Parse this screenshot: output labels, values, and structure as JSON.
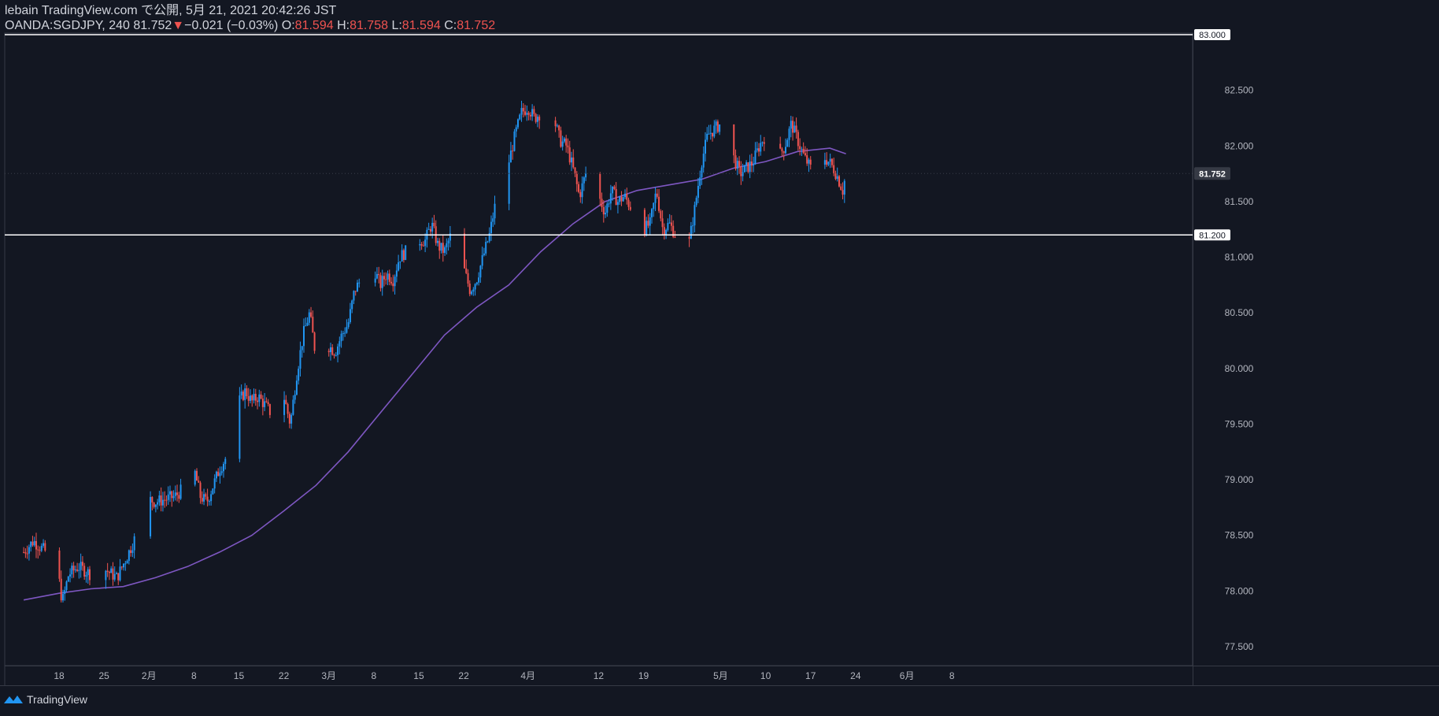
{
  "header": {
    "publish_line": "lebain TradingView.com で公開, 5月 21, 2021 20:42:26 JST",
    "symbol": "OANDA:SGDJPY, 240",
    "last": "81.752",
    "change_arrow": "▼",
    "change": "−0.021 (−0.03%)",
    "o_label": "O:",
    "o_value": "81.594",
    "h_label": "H:",
    "h_value": "81.758",
    "l_label": "L:",
    "l_value": "81.594",
    "c_label": "C:",
    "c_value": "81.752"
  },
  "footer": {
    "brand": "TradingView",
    "logo_icon": "tradingview-logo-icon"
  },
  "colors": {
    "background": "#131722",
    "up": "#2196f3",
    "down": "#ef5350",
    "ma": "#7e57c2",
    "hline": "#ffffff",
    "axis_text": "#b2b5be"
  },
  "chart_data": {
    "type": "candlestick",
    "symbol": "OANDA:SGDJPY",
    "interval": "240",
    "ylim": [
      77.3,
      83.0
    ],
    "y_ticks": [
      "83.000",
      "82.500",
      "82.000",
      "81.500",
      "81.000",
      "80.500",
      "80.000",
      "79.500",
      "79.000",
      "78.500",
      "78.000",
      "77.500"
    ],
    "y_tick_values": [
      83.0,
      82.5,
      82.0,
      81.5,
      81.0,
      80.5,
      80.0,
      79.5,
      79.0,
      78.5,
      78.0,
      77.5
    ],
    "x_ticks": [
      {
        "label": "18",
        "day": 0
      },
      {
        "label": "25",
        "day": 7
      },
      {
        "label": "2月",
        "day": 14
      },
      {
        "label": "8",
        "day": 21
      },
      {
        "label": "15",
        "day": 28
      },
      {
        "label": "22",
        "day": 35
      },
      {
        "label": "3月",
        "day": 42
      },
      {
        "label": "8",
        "day": 49
      },
      {
        "label": "15",
        "day": 56
      },
      {
        "label": "22",
        "day": 63
      },
      {
        "label": "4月",
        "day": 73
      },
      {
        "label": "12",
        "day": 84
      },
      {
        "label": "19",
        "day": 91
      },
      {
        "label": "5月",
        "day": 103
      },
      {
        "label": "10",
        "day": 110
      },
      {
        "label": "17",
        "day": 117
      },
      {
        "label": "24",
        "day": 124
      },
      {
        "label": "6月",
        "day": 132
      },
      {
        "label": "8",
        "day": 139
      }
    ],
    "price_path": [
      [
        -5.5,
        78.35
      ],
      [
        -4,
        78.45
      ],
      [
        -2,
        78.35
      ],
      [
        -1,
        78.4
      ],
      [
        0,
        78.1
      ],
      [
        0.5,
        77.9
      ],
      [
        1.5,
        78.15
      ],
      [
        3,
        78.22
      ],
      [
        5,
        78.15
      ],
      [
        7,
        78.2
      ],
      [
        9,
        78.12
      ],
      [
        10.5,
        78.3
      ],
      [
        12,
        78.5
      ],
      [
        13,
        78.85
      ],
      [
        15,
        78.8
      ],
      [
        18,
        78.85
      ],
      [
        20,
        78.95
      ],
      [
        21,
        79.1
      ],
      [
        22,
        78.85
      ],
      [
        23,
        78.8
      ],
      [
        24,
        78.95
      ],
      [
        25,
        79.1
      ],
      [
        27,
        79.3
      ],
      [
        28,
        79.7
      ],
      [
        29,
        79.8
      ],
      [
        30,
        79.7
      ],
      [
        31,
        79.75
      ],
      [
        33,
        79.6
      ],
      [
        34,
        79.65
      ],
      [
        35,
        79.75
      ],
      [
        36,
        79.5
      ],
      [
        37,
        79.95
      ],
      [
        38,
        80.3
      ],
      [
        39,
        80.5
      ],
      [
        40,
        80.1
      ],
      [
        41,
        80.0
      ],
      [
        42,
        80.2
      ],
      [
        43,
        80.15
      ],
      [
        44,
        80.3
      ],
      [
        45,
        80.4
      ],
      [
        46,
        80.7
      ],
      [
        47,
        80.8
      ],
      [
        48,
        80.7
      ],
      [
        49,
        80.9
      ],
      [
        50,
        80.75
      ],
      [
        51,
        80.85
      ],
      [
        52,
        80.8
      ],
      [
        53,
        81.0
      ],
      [
        55,
        81.1
      ],
      [
        56,
        81.15
      ],
      [
        57,
        81.15
      ],
      [
        58,
        81.3
      ],
      [
        59,
        81.1
      ],
      [
        60,
        81.05
      ],
      [
        61,
        81.2
      ],
      [
        62,
        81.15
      ],
      [
        63,
        80.9
      ],
      [
        64,
        80.7
      ],
      [
        65,
        80.8
      ],
      [
        66,
        81.0
      ],
      [
        67,
        81.2
      ],
      [
        68,
        81.5
      ],
      [
        69,
        81.6
      ],
      [
        70,
        81.85
      ],
      [
        71,
        82.1
      ],
      [
        72,
        82.3
      ],
      [
        73,
        82.35
      ],
      [
        74,
        82.25
      ],
      [
        75,
        82.3
      ],
      [
        76,
        82.2
      ],
      [
        77,
        82.25
      ],
      [
        78,
        82.05
      ],
      [
        79,
        82.0
      ],
      [
        80,
        81.8
      ],
      [
        81,
        81.55
      ],
      [
        82,
        81.75
      ],
      [
        83,
        81.65
      ],
      [
        84,
        81.55
      ],
      [
        85,
        81.4
      ],
      [
        86,
        81.6
      ],
      [
        87,
        81.5
      ],
      [
        88,
        81.55
      ],
      [
        89,
        81.45
      ],
      [
        90,
        81.3
      ],
      [
        91,
        81.25
      ],
      [
        92,
        81.3
      ],
      [
        93,
        81.6
      ],
      [
        94,
        81.25
      ],
      [
        95,
        81.3
      ],
      [
        96,
        81.2
      ],
      [
        97,
        81.2
      ],
      [
        98,
        81.1
      ],
      [
        99,
        81.45
      ],
      [
        100,
        81.85
      ],
      [
        101,
        82.1
      ],
      [
        102,
        82.15
      ],
      [
        103,
        82.2
      ],
      [
        104,
        82.25
      ],
      [
        105,
        81.9
      ],
      [
        106,
        81.75
      ],
      [
        107,
        81.8
      ],
      [
        108,
        81.85
      ],
      [
        109,
        82.0
      ],
      [
        110,
        82.1
      ],
      [
        111,
        81.95
      ],
      [
        112,
        81.9
      ],
      [
        113,
        82.0
      ],
      [
        114,
        82.2
      ],
      [
        115,
        82.05
      ],
      [
        116,
        81.9
      ],
      [
        117,
        81.8
      ],
      [
        118,
        81.95
      ],
      [
        119,
        81.9
      ],
      [
        120,
        81.85
      ],
      [
        121,
        81.75
      ],
      [
        122,
        81.6
      ],
      [
        122.5,
        81.752
      ]
    ],
    "ma_path": [
      [
        -5.5,
        77.92
      ],
      [
        0,
        77.98
      ],
      [
        5,
        78.02
      ],
      [
        10,
        78.04
      ],
      [
        15,
        78.12
      ],
      [
        20,
        78.22
      ],
      [
        25,
        78.35
      ],
      [
        30,
        78.5
      ],
      [
        35,
        78.72
      ],
      [
        40,
        78.95
      ],
      [
        45,
        79.25
      ],
      [
        50,
        79.6
      ],
      [
        55,
        79.95
      ],
      [
        60,
        80.3
      ],
      [
        65,
        80.55
      ],
      [
        70,
        80.75
      ],
      [
        75,
        81.05
      ],
      [
        80,
        81.3
      ],
      [
        85,
        81.5
      ],
      [
        90,
        81.6
      ],
      [
        95,
        81.65
      ],
      [
        100,
        81.7
      ],
      [
        105,
        81.8
      ],
      [
        110,
        81.86
      ],
      [
        115,
        81.95
      ],
      [
        120,
        81.98
      ],
      [
        122.5,
        81.93
      ]
    ],
    "horizontal_lines": [
      {
        "value": 81.2,
        "label": "81.200"
      },
      {
        "value": 83.0,
        "label": "83.000"
      }
    ],
    "last_price": {
      "value": 81.752,
      "label": "81.752"
    },
    "grid": false,
    "legend": "none"
  }
}
